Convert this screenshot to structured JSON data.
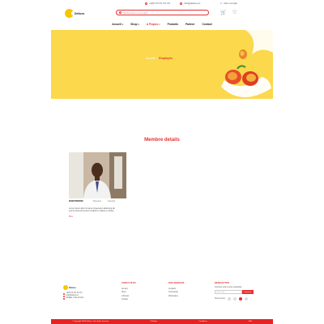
{
  "topbar": {
    "phone": "+225 XX XX XX XX",
    "email": "info@delices.ci",
    "account": "Mon compte"
  },
  "header": {
    "logo_text": "Délices",
    "search_placeholder": "Rechercher un produit..."
  },
  "nav": {
    "items": [
      {
        "label": "Accueil",
        "has_dropdown": true
      },
      {
        "label": "Shop",
        "has_dropdown": true
      },
      {
        "label": "A Propos",
        "has_dropdown": true,
        "active": true
      },
      {
        "label": "Produits",
        "has_dropdown": false
      },
      {
        "label": "Partner",
        "has_dropdown": false
      },
      {
        "label": "Contact",
        "has_dropdown": false
      }
    ]
  },
  "hero": {
    "breadcrumb_home": "Accueil",
    "breadcrumb_sep": "/",
    "breadcrumb_current": "Employés",
    "bg_color": "#fbd84c"
  },
  "section": {
    "title": "Membre details"
  },
  "member": {
    "name": "NOM PRENOM",
    "role": "Directeur",
    "role2": "Général",
    "bio": "Lorem ipsum dolor sit amet consectetur adipiscing elit sed do eiusmod tempor incididunt ut labore et dolore.",
    "more": "Plus"
  },
  "footer": {
    "logo_text": "Délices",
    "contacts": [
      "+225 XX XX XX XX",
      "info@delices.ci",
      "Abidjan, Côte d'Ivoire"
    ],
    "col1": {
      "title": "LIENS UTILES",
      "links": [
        "Accueil",
        "Shop",
        "A Propos",
        "Contact"
      ]
    },
    "col2": {
      "title": "NOS SERVICES",
      "links": [
        "Livraison",
        "Commande",
        "Partenaires"
      ]
    },
    "newsletter": {
      "title": "NEWSLETTER",
      "text": "Inscrivez-vous à notre newsletter",
      "placeholder": "Votre email",
      "button": "S'inscrire",
      "follow": "Suivez-nous"
    }
  },
  "bottombar": {
    "copyright": "© Copyright 2023 Délices. Tous droits réservés",
    "links": [
      "Politique",
      "Conditions",
      "Aide"
    ]
  },
  "colors": {
    "accent": "#e63030",
    "yellow": "#f7c600"
  }
}
